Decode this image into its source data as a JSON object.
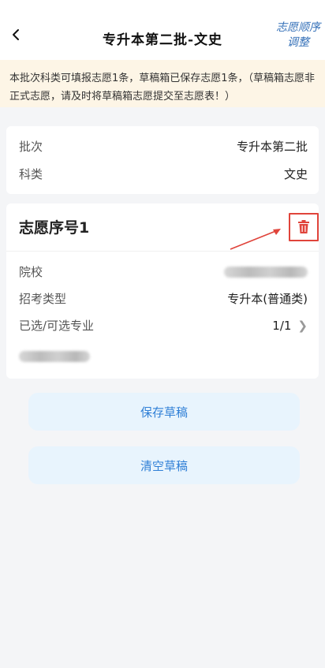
{
  "header": {
    "title": "专升本第二批-文史",
    "adjust_line1": "志愿顺序",
    "adjust_line2": "调整"
  },
  "notice": {
    "text": "本批次科类可填报志愿1条，草稿箱已保存志愿1条，（草稿箱志愿非正式志愿，请及时将草稿箱志愿提交至志愿表！）"
  },
  "batch_card": {
    "batch_label": "批次",
    "batch_value": "专升本第二批",
    "category_label": "科类",
    "category_value": "文史"
  },
  "preference_card": {
    "title": "志愿序号1",
    "school_label": "院校",
    "exam_type_label": "招考类型",
    "exam_type_value": "专升本(普通类)",
    "majors_label": "已选/可选专业",
    "majors_value": "1/1"
  },
  "actions": {
    "save_label": "保存草稿",
    "clear_label": "清空草稿"
  },
  "colors": {
    "accent_blue": "#2f7fd6",
    "button_bg": "#e8f4fd",
    "notice_bg": "#fdf5e6",
    "delete_red": "#e0443b"
  },
  "icons": [
    "back-arrow-icon",
    "trash-icon",
    "chevron-right-icon",
    "annotation-arrow"
  ]
}
